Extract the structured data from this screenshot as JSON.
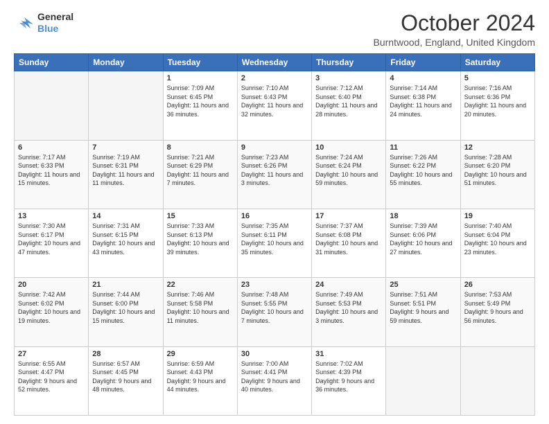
{
  "header": {
    "logo_line1": "General",
    "logo_line2": "Blue",
    "month_title": "October 2024",
    "location": "Burntwood, England, United Kingdom"
  },
  "days_of_week": [
    "Sunday",
    "Monday",
    "Tuesday",
    "Wednesday",
    "Thursday",
    "Friday",
    "Saturday"
  ],
  "weeks": [
    [
      {
        "day": "",
        "info": ""
      },
      {
        "day": "",
        "info": ""
      },
      {
        "day": "1",
        "info": "Sunrise: 7:09 AM\nSunset: 6:45 PM\nDaylight: 11 hours and 36 minutes."
      },
      {
        "day": "2",
        "info": "Sunrise: 7:10 AM\nSunset: 6:43 PM\nDaylight: 11 hours and 32 minutes."
      },
      {
        "day": "3",
        "info": "Sunrise: 7:12 AM\nSunset: 6:40 PM\nDaylight: 11 hours and 28 minutes."
      },
      {
        "day": "4",
        "info": "Sunrise: 7:14 AM\nSunset: 6:38 PM\nDaylight: 11 hours and 24 minutes."
      },
      {
        "day": "5",
        "info": "Sunrise: 7:16 AM\nSunset: 6:36 PM\nDaylight: 11 hours and 20 minutes."
      }
    ],
    [
      {
        "day": "6",
        "info": "Sunrise: 7:17 AM\nSunset: 6:33 PM\nDaylight: 11 hours and 15 minutes."
      },
      {
        "day": "7",
        "info": "Sunrise: 7:19 AM\nSunset: 6:31 PM\nDaylight: 11 hours and 11 minutes."
      },
      {
        "day": "8",
        "info": "Sunrise: 7:21 AM\nSunset: 6:29 PM\nDaylight: 11 hours and 7 minutes."
      },
      {
        "day": "9",
        "info": "Sunrise: 7:23 AM\nSunset: 6:26 PM\nDaylight: 11 hours and 3 minutes."
      },
      {
        "day": "10",
        "info": "Sunrise: 7:24 AM\nSunset: 6:24 PM\nDaylight: 10 hours and 59 minutes."
      },
      {
        "day": "11",
        "info": "Sunrise: 7:26 AM\nSunset: 6:22 PM\nDaylight: 10 hours and 55 minutes."
      },
      {
        "day": "12",
        "info": "Sunrise: 7:28 AM\nSunset: 6:20 PM\nDaylight: 10 hours and 51 minutes."
      }
    ],
    [
      {
        "day": "13",
        "info": "Sunrise: 7:30 AM\nSunset: 6:17 PM\nDaylight: 10 hours and 47 minutes."
      },
      {
        "day": "14",
        "info": "Sunrise: 7:31 AM\nSunset: 6:15 PM\nDaylight: 10 hours and 43 minutes."
      },
      {
        "day": "15",
        "info": "Sunrise: 7:33 AM\nSunset: 6:13 PM\nDaylight: 10 hours and 39 minutes."
      },
      {
        "day": "16",
        "info": "Sunrise: 7:35 AM\nSunset: 6:11 PM\nDaylight: 10 hours and 35 minutes."
      },
      {
        "day": "17",
        "info": "Sunrise: 7:37 AM\nSunset: 6:08 PM\nDaylight: 10 hours and 31 minutes."
      },
      {
        "day": "18",
        "info": "Sunrise: 7:39 AM\nSunset: 6:06 PM\nDaylight: 10 hours and 27 minutes."
      },
      {
        "day": "19",
        "info": "Sunrise: 7:40 AM\nSunset: 6:04 PM\nDaylight: 10 hours and 23 minutes."
      }
    ],
    [
      {
        "day": "20",
        "info": "Sunrise: 7:42 AM\nSunset: 6:02 PM\nDaylight: 10 hours and 19 minutes."
      },
      {
        "day": "21",
        "info": "Sunrise: 7:44 AM\nSunset: 6:00 PM\nDaylight: 10 hours and 15 minutes."
      },
      {
        "day": "22",
        "info": "Sunrise: 7:46 AM\nSunset: 5:58 PM\nDaylight: 10 hours and 11 minutes."
      },
      {
        "day": "23",
        "info": "Sunrise: 7:48 AM\nSunset: 5:55 PM\nDaylight: 10 hours and 7 minutes."
      },
      {
        "day": "24",
        "info": "Sunrise: 7:49 AM\nSunset: 5:53 PM\nDaylight: 10 hours and 3 minutes."
      },
      {
        "day": "25",
        "info": "Sunrise: 7:51 AM\nSunset: 5:51 PM\nDaylight: 9 hours and 59 minutes."
      },
      {
        "day": "26",
        "info": "Sunrise: 7:53 AM\nSunset: 5:49 PM\nDaylight: 9 hours and 56 minutes."
      }
    ],
    [
      {
        "day": "27",
        "info": "Sunrise: 6:55 AM\nSunset: 4:47 PM\nDaylight: 9 hours and 52 minutes."
      },
      {
        "day": "28",
        "info": "Sunrise: 6:57 AM\nSunset: 4:45 PM\nDaylight: 9 hours and 48 minutes."
      },
      {
        "day": "29",
        "info": "Sunrise: 6:59 AM\nSunset: 4:43 PM\nDaylight: 9 hours and 44 minutes."
      },
      {
        "day": "30",
        "info": "Sunrise: 7:00 AM\nSunset: 4:41 PM\nDaylight: 9 hours and 40 minutes."
      },
      {
        "day": "31",
        "info": "Sunrise: 7:02 AM\nSunset: 4:39 PM\nDaylight: 9 hours and 36 minutes."
      },
      {
        "day": "",
        "info": ""
      },
      {
        "day": "",
        "info": ""
      }
    ]
  ]
}
